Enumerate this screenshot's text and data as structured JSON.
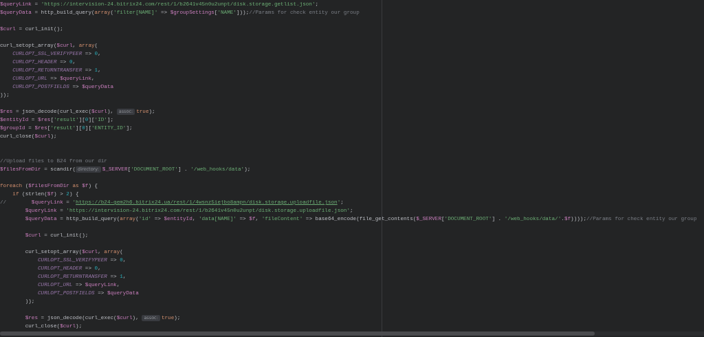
{
  "editor": {
    "lines": [
      {
        "kind": "code",
        "tokens": [
          {
            "kind": "var",
            "text": "$queryLink"
          },
          {
            "kind": "plain",
            "text": " = "
          },
          {
            "kind": "string",
            "text": "'https://intervision-24.bitrix24.com/rest/1/b2641v45n0u2unpt/disk.storage.getlist.json'"
          },
          {
            "kind": "plain",
            "text": ";"
          }
        ]
      },
      {
        "kind": "code",
        "tokens": [
          {
            "kind": "var",
            "text": "$queryData"
          },
          {
            "kind": "plain",
            "text": " = http_build_query("
          },
          {
            "kind": "keyword",
            "text": "array"
          },
          {
            "kind": "plain",
            "text": "("
          },
          {
            "kind": "string",
            "text": "'filter[NAME]'"
          },
          {
            "kind": "plain",
            "text": " => "
          },
          {
            "kind": "var",
            "text": "$groupSettings"
          },
          {
            "kind": "plain",
            "text": "["
          },
          {
            "kind": "string",
            "text": "'NAME'"
          },
          {
            "kind": "plain",
            "text": "]));"
          },
          {
            "kind": "comment",
            "text": "//Params for check entity our group"
          }
        ]
      },
      {
        "kind": "blank"
      },
      {
        "kind": "code",
        "tokens": [
          {
            "kind": "var",
            "text": "$curl"
          },
          {
            "kind": "plain",
            "text": " = curl_init();"
          }
        ]
      },
      {
        "kind": "blank"
      },
      {
        "kind": "code",
        "tokens": [
          {
            "kind": "plain",
            "text": "curl_setopt_array("
          },
          {
            "kind": "var",
            "text": "$curl"
          },
          {
            "kind": "plain",
            "text": ", "
          },
          {
            "kind": "keyword",
            "text": "array"
          },
          {
            "kind": "plain",
            "text": "("
          }
        ]
      },
      {
        "kind": "code",
        "tokens": [
          {
            "kind": "constant",
            "text": "    CURLOPT_SSL_VERIFYPEER"
          },
          {
            "kind": "plain",
            "text": " => "
          },
          {
            "kind": "number",
            "text": "0"
          },
          {
            "kind": "plain",
            "text": ","
          }
        ]
      },
      {
        "kind": "code",
        "tokens": [
          {
            "kind": "constant",
            "text": "    CURLOPT_HEADER"
          },
          {
            "kind": "plain",
            "text": " => "
          },
          {
            "kind": "number",
            "text": "0"
          },
          {
            "kind": "plain",
            "text": ","
          }
        ]
      },
      {
        "kind": "code",
        "tokens": [
          {
            "kind": "constant",
            "text": "    CURLOPT_RETURNTRANSFER"
          },
          {
            "kind": "plain",
            "text": " => "
          },
          {
            "kind": "number",
            "text": "1"
          },
          {
            "kind": "plain",
            "text": ","
          }
        ]
      },
      {
        "kind": "code",
        "tokens": [
          {
            "kind": "constant",
            "text": "    CURLOPT_URL"
          },
          {
            "kind": "plain",
            "text": " => "
          },
          {
            "kind": "var",
            "text": "$queryLink"
          },
          {
            "kind": "plain",
            "text": ","
          }
        ]
      },
      {
        "kind": "code",
        "tokens": [
          {
            "kind": "constant",
            "text": "    CURLOPT_POSTFIELDS"
          },
          {
            "kind": "plain",
            "text": " => "
          },
          {
            "kind": "var",
            "text": "$queryData"
          }
        ]
      },
      {
        "kind": "code",
        "tokens": [
          {
            "kind": "plain",
            "text": "));"
          }
        ]
      },
      {
        "kind": "blank"
      },
      {
        "kind": "code",
        "tokens": [
          {
            "kind": "var",
            "text": "$res"
          },
          {
            "kind": "plain",
            "text": " = json_decode(curl_exec("
          },
          {
            "kind": "var",
            "text": "$curl"
          },
          {
            "kind": "plain",
            "text": "), "
          },
          {
            "kind": "hint",
            "text": "assoc:"
          },
          {
            "kind": "keyword",
            "text": "true"
          },
          {
            "kind": "plain",
            "text": ");"
          }
        ]
      },
      {
        "kind": "code",
        "tokens": [
          {
            "kind": "var",
            "text": "$entityId"
          },
          {
            "kind": "plain",
            "text": " = "
          },
          {
            "kind": "var",
            "text": "$res"
          },
          {
            "kind": "plain",
            "text": "["
          },
          {
            "kind": "string",
            "text": "'result'"
          },
          {
            "kind": "plain",
            "text": "]["
          },
          {
            "kind": "number",
            "text": "0"
          },
          {
            "kind": "plain",
            "text": "]["
          },
          {
            "kind": "string",
            "text": "'ID'"
          },
          {
            "kind": "plain",
            "text": "];"
          }
        ]
      },
      {
        "kind": "code",
        "tokens": [
          {
            "kind": "var",
            "text": "$groupId"
          },
          {
            "kind": "plain",
            "text": " = "
          },
          {
            "kind": "var",
            "text": "$res"
          },
          {
            "kind": "plain",
            "text": "["
          },
          {
            "kind": "string",
            "text": "'result'"
          },
          {
            "kind": "plain",
            "text": "]["
          },
          {
            "kind": "number",
            "text": "0"
          },
          {
            "kind": "plain",
            "text": "]["
          },
          {
            "kind": "string",
            "text": "'ENTITY_ID'"
          },
          {
            "kind": "plain",
            "text": "];"
          }
        ]
      },
      {
        "kind": "code",
        "tokens": [
          {
            "kind": "plain",
            "text": "curl_close("
          },
          {
            "kind": "var",
            "text": "$curl"
          },
          {
            "kind": "plain",
            "text": ");"
          }
        ]
      },
      {
        "kind": "blank"
      },
      {
        "kind": "blank"
      },
      {
        "kind": "code",
        "tokens": [
          {
            "kind": "comment",
            "text": "//Upload files to B24 from our dir"
          }
        ]
      },
      {
        "kind": "code",
        "tokens": [
          {
            "kind": "var",
            "text": "$filesFromDir"
          },
          {
            "kind": "plain",
            "text": " = scandir("
          },
          {
            "kind": "hint",
            "text": "directory:"
          },
          {
            "kind": "var",
            "text": "$_SERVER"
          },
          {
            "kind": "plain",
            "text": "["
          },
          {
            "kind": "string",
            "text": "'DOCUMENT_ROOT'"
          },
          {
            "kind": "plain",
            "text": "] . "
          },
          {
            "kind": "string",
            "text": "'/web_hooks/data'"
          },
          {
            "kind": "plain",
            "text": ");"
          }
        ]
      },
      {
        "kind": "blank"
      },
      {
        "kind": "code",
        "tokens": [
          {
            "kind": "keyword",
            "text": "foreach"
          },
          {
            "kind": "plain",
            "text": " ("
          },
          {
            "kind": "var",
            "text": "$filesFromDir"
          },
          {
            "kind": "keyword",
            "text": " as "
          },
          {
            "kind": "var",
            "text": "$f"
          },
          {
            "kind": "plain",
            "text": ") {"
          }
        ]
      },
      {
        "kind": "code",
        "tokens": [
          {
            "kind": "keyword",
            "text": "    if"
          },
          {
            "kind": "plain",
            "text": " (strlen("
          },
          {
            "kind": "var",
            "text": "$f"
          },
          {
            "kind": "plain",
            "text": ") > "
          },
          {
            "kind": "number",
            "text": "2"
          },
          {
            "kind": "plain",
            "text": ") {"
          }
        ]
      },
      {
        "kind": "code",
        "tokens": [
          {
            "kind": "comment",
            "text": "//        "
          },
          {
            "kind": "var",
            "text": "$queryLink"
          },
          {
            "kind": "plain",
            "text": " = "
          },
          {
            "kind": "string",
            "text": "'"
          },
          {
            "kind": "url",
            "text": "https://b24-gem2h6.bitrix24.ua/rest/1/4wsnz5iejbo8ampn/disk.storage.uploadfile.json"
          },
          {
            "kind": "string",
            "text": "'"
          },
          {
            "kind": "plain",
            "text": ";"
          }
        ]
      },
      {
        "kind": "code",
        "tokens": [
          {
            "kind": "var",
            "text": "        $queryLink"
          },
          {
            "kind": "plain",
            "text": " = "
          },
          {
            "kind": "string",
            "text": "'https://intervision-24.bitrix24.com/rest/1/b2641v45n0u2unpt/disk.storage.uploadfile.json'"
          },
          {
            "kind": "plain",
            "text": ";"
          }
        ]
      },
      {
        "kind": "code",
        "tokens": [
          {
            "kind": "var",
            "text": "        $queryData"
          },
          {
            "kind": "plain",
            "text": " = http_build_query("
          },
          {
            "kind": "keyword",
            "text": "array"
          },
          {
            "kind": "plain",
            "text": "("
          },
          {
            "kind": "string",
            "text": "'id'"
          },
          {
            "kind": "plain",
            "text": " => "
          },
          {
            "kind": "var",
            "text": "$entityId"
          },
          {
            "kind": "plain",
            "text": ", "
          },
          {
            "kind": "string",
            "text": "'data[NAME]'"
          },
          {
            "kind": "plain",
            "text": " => "
          },
          {
            "kind": "var",
            "text": "$f"
          },
          {
            "kind": "plain",
            "text": ", "
          },
          {
            "kind": "string",
            "text": "'fileContent'"
          },
          {
            "kind": "plain",
            "text": " => base64_encode(file_get_contents("
          },
          {
            "kind": "var",
            "text": "$_SERVER"
          },
          {
            "kind": "plain",
            "text": "["
          },
          {
            "kind": "string",
            "text": "'DOCUMENT_ROOT'"
          },
          {
            "kind": "plain",
            "text": "] . "
          },
          {
            "kind": "string",
            "text": "'/web_hooks/data/'"
          },
          {
            "kind": "plain",
            "text": "."
          },
          {
            "kind": "var",
            "text": "$f"
          },
          {
            "kind": "plain",
            "text": "))));"
          },
          {
            "kind": "comment",
            "text": "//Params for check entity our group"
          }
        ]
      },
      {
        "kind": "blank"
      },
      {
        "kind": "code",
        "tokens": [
          {
            "kind": "var",
            "text": "        $curl"
          },
          {
            "kind": "plain",
            "text": " = curl_init();"
          }
        ]
      },
      {
        "kind": "blank"
      },
      {
        "kind": "code",
        "tokens": [
          {
            "kind": "plain",
            "text": "        curl_setopt_array("
          },
          {
            "kind": "var",
            "text": "$curl"
          },
          {
            "kind": "plain",
            "text": ", "
          },
          {
            "kind": "keyword",
            "text": "array"
          },
          {
            "kind": "plain",
            "text": "("
          }
        ]
      },
      {
        "kind": "code",
        "tokens": [
          {
            "kind": "constant",
            "text": "            CURLOPT_SSL_VERIFYPEER"
          },
          {
            "kind": "plain",
            "text": " => "
          },
          {
            "kind": "number",
            "text": "0"
          },
          {
            "kind": "plain",
            "text": ","
          }
        ]
      },
      {
        "kind": "code",
        "tokens": [
          {
            "kind": "constant",
            "text": "            CURLOPT_HEADER"
          },
          {
            "kind": "plain",
            "text": " => "
          },
          {
            "kind": "number",
            "text": "0"
          },
          {
            "kind": "plain",
            "text": ","
          }
        ]
      },
      {
        "kind": "code",
        "tokens": [
          {
            "kind": "constant",
            "text": "            CURLOPT_RETURNTRANSFER"
          },
          {
            "kind": "plain",
            "text": " => "
          },
          {
            "kind": "number",
            "text": "1"
          },
          {
            "kind": "plain",
            "text": ","
          }
        ]
      },
      {
        "kind": "code",
        "tokens": [
          {
            "kind": "constant",
            "text": "            CURLOPT_URL"
          },
          {
            "kind": "plain",
            "text": " => "
          },
          {
            "kind": "var",
            "text": "$queryLink"
          },
          {
            "kind": "plain",
            "text": ","
          }
        ]
      },
      {
        "kind": "code",
        "tokens": [
          {
            "kind": "constant",
            "text": "            CURLOPT_POSTFIELDS"
          },
          {
            "kind": "plain",
            "text": " => "
          },
          {
            "kind": "var",
            "text": "$queryData"
          }
        ]
      },
      {
        "kind": "code",
        "tokens": [
          {
            "kind": "plain",
            "text": "        ));"
          }
        ]
      },
      {
        "kind": "blank"
      },
      {
        "kind": "code",
        "tokens": [
          {
            "kind": "var",
            "text": "        $res"
          },
          {
            "kind": "plain",
            "text": " = json_decode(curl_exec("
          },
          {
            "kind": "var",
            "text": "$curl"
          },
          {
            "kind": "plain",
            "text": "), "
          },
          {
            "kind": "hint",
            "text": "assoc:"
          },
          {
            "kind": "keyword",
            "text": "true"
          },
          {
            "kind": "plain",
            "text": ");"
          }
        ]
      },
      {
        "kind": "code",
        "tokens": [
          {
            "kind": "plain",
            "text": "        curl_close("
          },
          {
            "kind": "var",
            "text": "$curl"
          },
          {
            "kind": "plain",
            "text": ");"
          }
        ]
      }
    ]
  }
}
